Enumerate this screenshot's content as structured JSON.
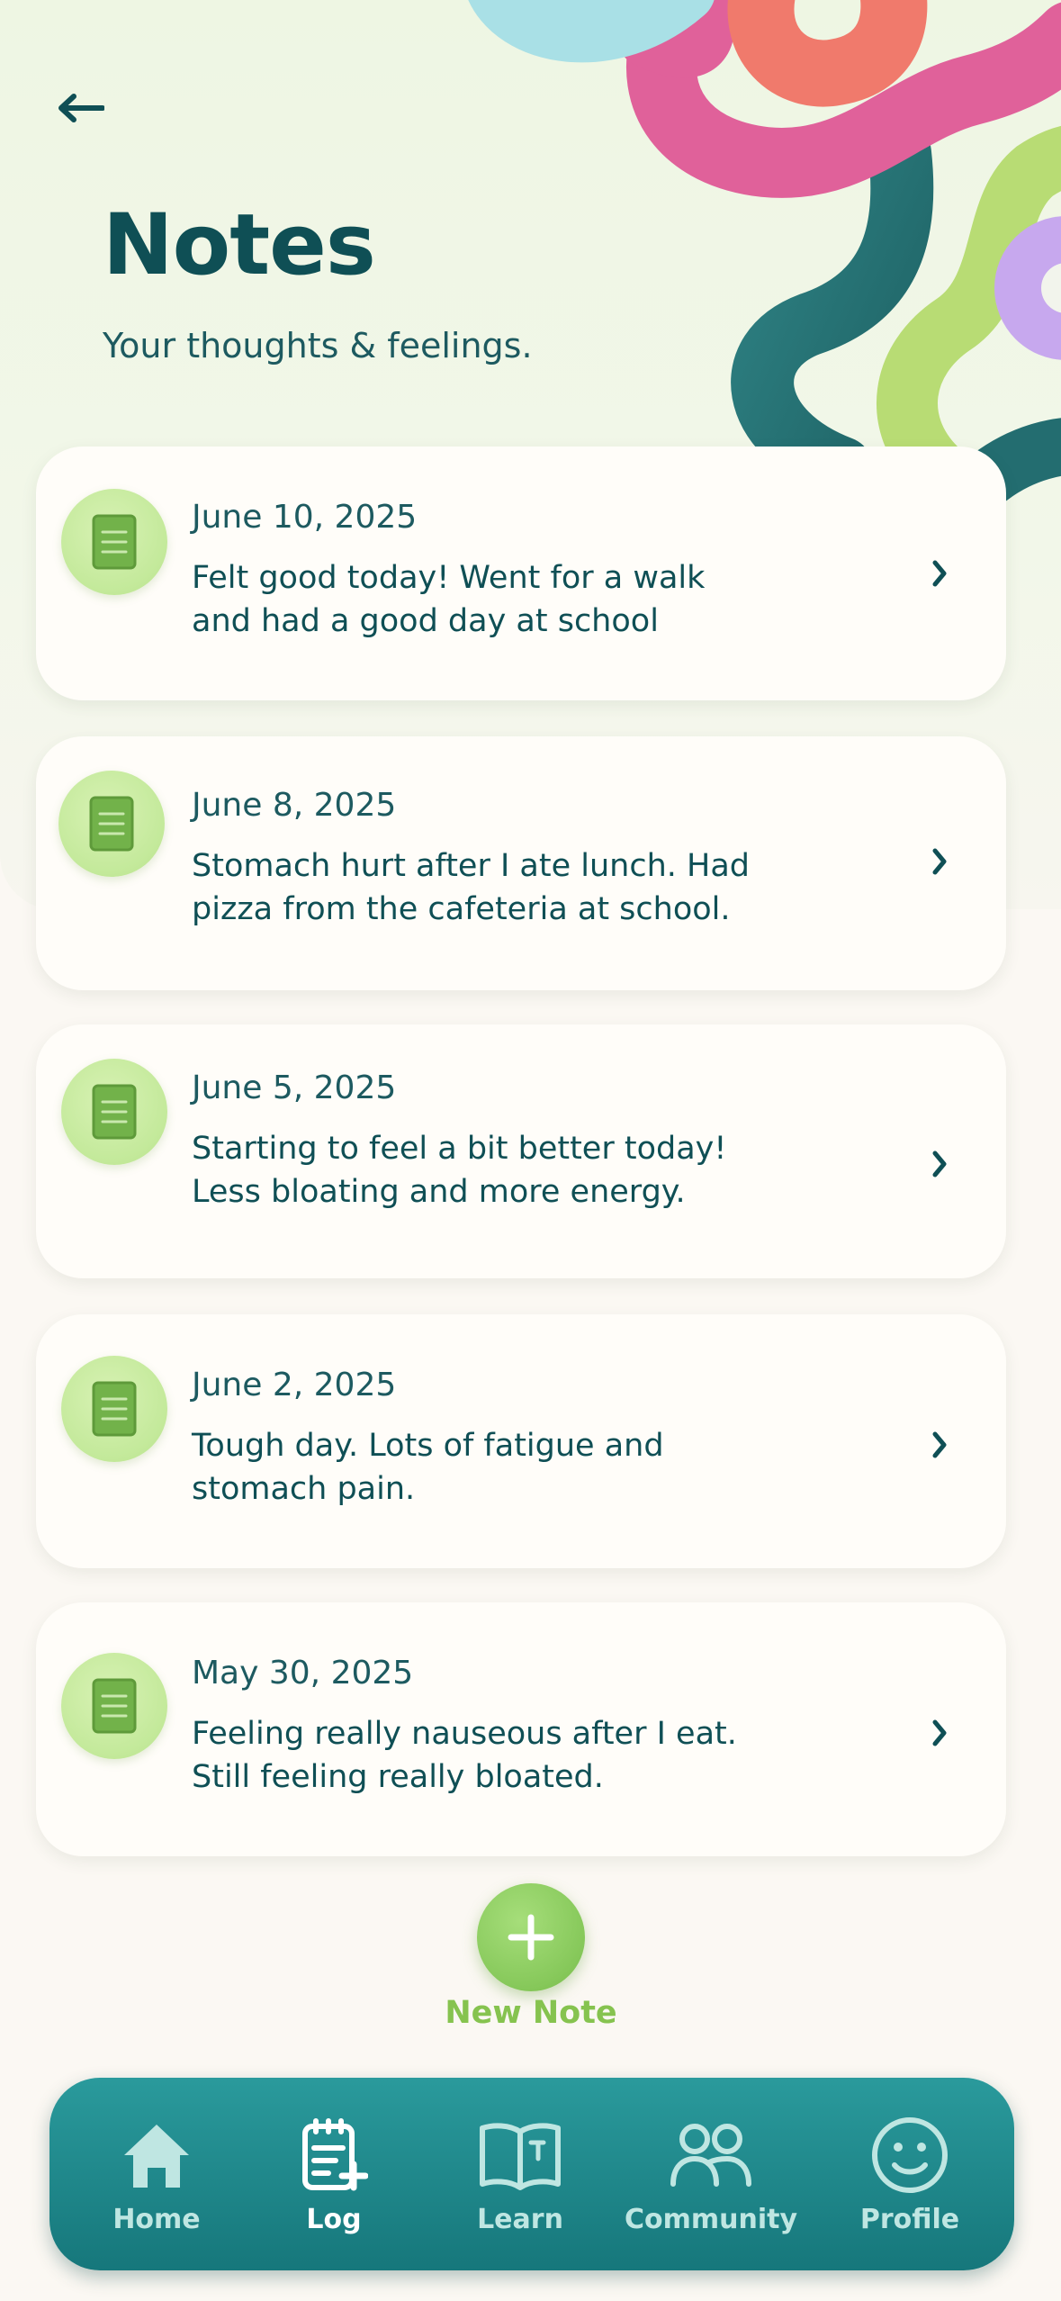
{
  "header": {
    "title": "Notes",
    "subtitle": "Your thoughts & feelings."
  },
  "notes": [
    {
      "date": "June 10, 2025",
      "text": "Felt good today! Went for a walk and had a good day at school"
    },
    {
      "date": "June 8, 2025",
      "text": "Stomach hurt after I ate lunch. Had pizza from the cafeteria at school."
    },
    {
      "date": "June 5, 2025",
      "text": "Starting to feel a bit better today! Less bloating and more energy."
    },
    {
      "date": "June 2, 2025",
      "text": "Tough day. Lots of fatigue and stomach pain."
    },
    {
      "date": "May 30, 2025",
      "text": "Feeling really nauseous after I eat. Still feeling really bloated."
    }
  ],
  "new_note": {
    "label": "New Note",
    "icon": "plus-icon"
  },
  "tabbar": {
    "active": "Log",
    "items": [
      {
        "label": "Home",
        "icon": "home-icon"
      },
      {
        "label": "Log",
        "icon": "log-icon"
      },
      {
        "label": "Learn",
        "icon": "book-icon"
      },
      {
        "label": "Community",
        "icon": "people-icon"
      },
      {
        "label": "Profile",
        "icon": "smiley-icon"
      }
    ]
  },
  "colors": {
    "primary_text": "#0f4f55",
    "accent_green": "#86c34f",
    "tabbar": "#1f878a",
    "background": "#fbf8f3"
  }
}
